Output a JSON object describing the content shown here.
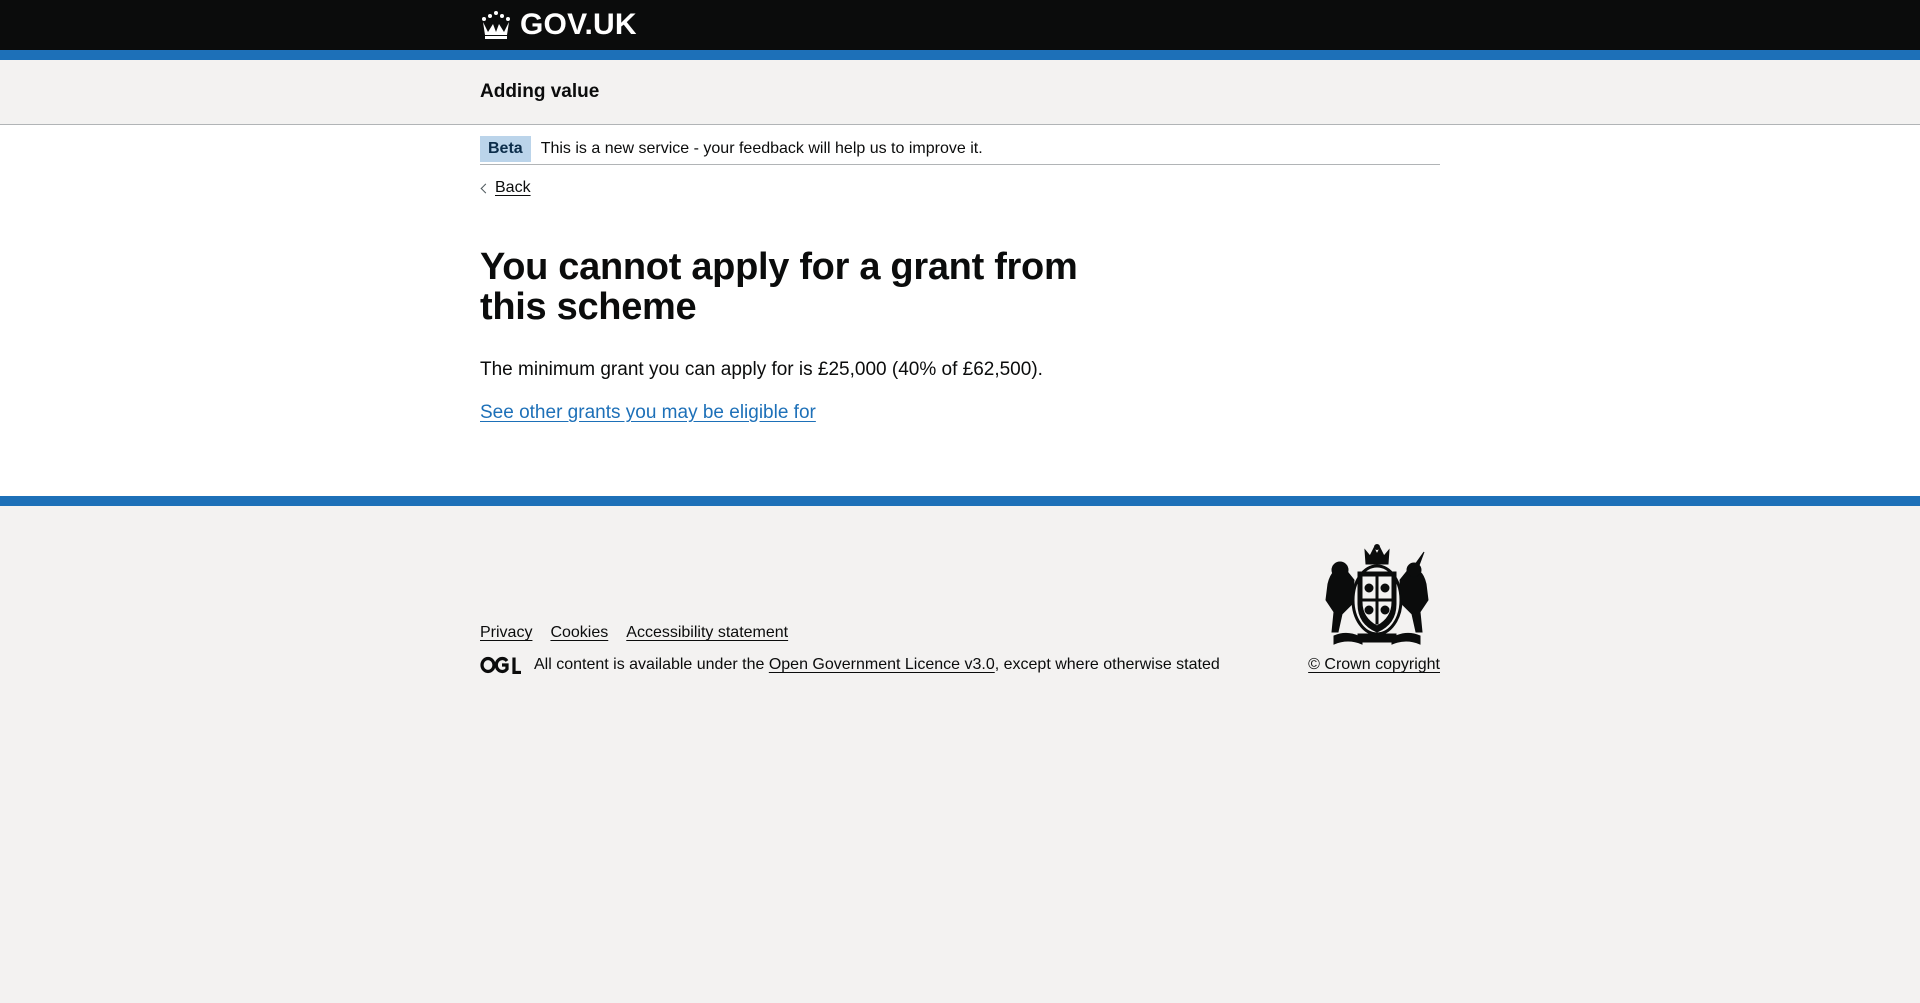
{
  "header": {
    "logo_text": "GOV.UK",
    "logo_icon": "crown-icon"
  },
  "service": {
    "name": "Adding value"
  },
  "phase_banner": {
    "tag": "Beta",
    "text": "This is a new service - your feedback will help us to improve it."
  },
  "nav": {
    "back_label": "Back"
  },
  "main": {
    "heading": "You cannot apply for a grant from this scheme",
    "body": "The minimum grant you can apply for is £25,000 (40% of £62,500).",
    "link_label": "See other grants you may be eligible for"
  },
  "footer": {
    "links": [
      "Privacy",
      "Cookies",
      "Accessibility statement"
    ],
    "licence_prefix": "All content is available under the ",
    "licence_link": "Open Government Licence v3.0",
    "licence_suffix": ", except where otherwise stated",
    "copyright": "© Crown copyright",
    "crest_icon": "royal-coat-of-arms-icon",
    "ogl_icon": "ogl-logo-icon"
  },
  "colors": {
    "header_bg": "#0b0c0c",
    "brand_blue": "#1d70b8",
    "tag_bg": "#bbd4ea",
    "page_bg": "#f3f2f1"
  }
}
